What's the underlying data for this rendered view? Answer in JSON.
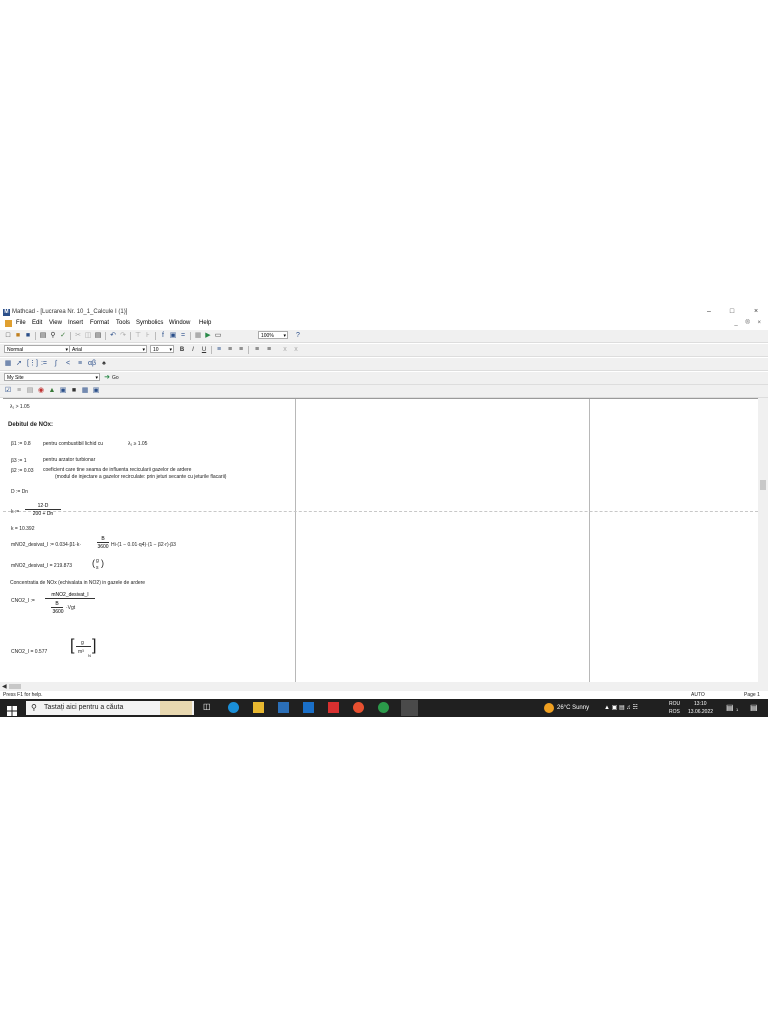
{
  "window": {
    "app_icon": "M",
    "title": "Mathcad - [Lucrarea Nr. 10_1_Calcule I (1)]",
    "controls": [
      "–",
      "□",
      "×"
    ]
  },
  "menubar": {
    "items": [
      "File",
      "Edit",
      "View",
      "Insert",
      "Format",
      "Tools",
      "Symbolics",
      "Window",
      "Help"
    ],
    "doc_controls": "_ ® ×"
  },
  "toolbar": {
    "zoom": "100%"
  },
  "format_bar": {
    "style": "Normal",
    "font": "Arial",
    "size": "10",
    "bold": "B",
    "italic": "I",
    "underline": "U"
  },
  "site_bar": {
    "site": "My Site",
    "go": "Go"
  },
  "worksheet": {
    "lambda_line": "λ₁ > 1.05",
    "heading": "Debitul de NOx:",
    "b1": "β1 := 0.8",
    "b1_note": "pentru combustibil lichid cu",
    "b1_cond": "λ₁ ≥ 1.05",
    "b3": "β3 := 1",
    "b3_note": "pentru arzator turbionar",
    "b2": "β2 := 0.03",
    "b2_note1": "coeficient care tine seama de influenta recicularii gazelor de ardere",
    "b2_note2": "(modul de injectare a gazelor recirculate: prin jeturi secante cu jeturile flacarii)",
    "d_def": "D := Dn",
    "k_lhs": "k :=",
    "k_num": "12·D",
    "k_den": "200 + Dn",
    "k_val": "k = 10.392",
    "mno2_lhs": "mNO2_desivat_I := 0.034·β1·k·",
    "mno2_num": "B",
    "mno2_den": "3600",
    "mno2_rest": "Hi·(1 − 0.01·q4)·(1 − β2·r)·β3",
    "mno2_val": "mNO2_desivat_I = 219.873",
    "mno2_unit_top": "g",
    "mno2_unit_bot": "s",
    "conc_title": "Concentratia de NOx (echivalata in NO2) in gazele de ardere",
    "cno2_lhs": "CNO2_I :=",
    "cno2_num": "mNO2_desivat_I",
    "cno2_den_num": "B",
    "cno2_den_den": "3600",
    "cno2_den_rest": "·Vgt",
    "cno2_val": "CNO2_I = 0.577",
    "cno2_unit_top": "g",
    "cno2_unit_bot": "m³",
    "cno2_unit_sub": "N"
  },
  "status": {
    "help": "Press F1 for help.",
    "mode": "AUTO",
    "page": "Page 1"
  },
  "taskbar": {
    "search_placeholder": "Tastați aici pentru a căuta",
    "weather": "26°C Sunny",
    "lang_top": "ROU",
    "lang_bot": "ROS",
    "time": "13:10",
    "date": "13.06.2022",
    "notification_count": "1"
  },
  "colors": {
    "taskbar": "#202020",
    "accent": "#2b4f8a"
  }
}
